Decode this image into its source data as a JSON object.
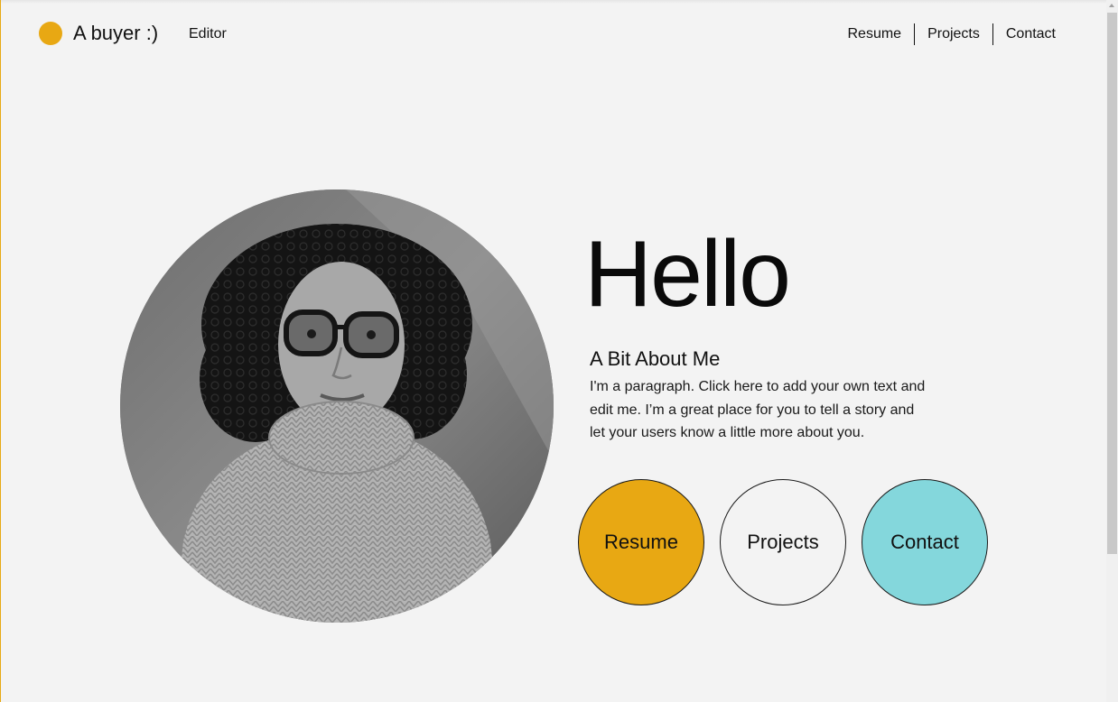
{
  "header": {
    "site_title": "A buyer :)",
    "role": "Editor",
    "nav": [
      "Resume",
      "Projects",
      "Contact"
    ]
  },
  "hero": {
    "greeting": "Hello",
    "about_heading": "A Bit About Me",
    "about_text": "I'm a paragraph. Click here to add your own text and edit me. I’m a great place for you to tell a story and let your users know a little more about you.",
    "buttons": {
      "resume": "Resume",
      "projects": "Projects",
      "contact": "Contact"
    }
  },
  "colors": {
    "accent_yellow": "#e8a813",
    "accent_teal": "#84d7dc",
    "background": "#f3f3f3"
  }
}
